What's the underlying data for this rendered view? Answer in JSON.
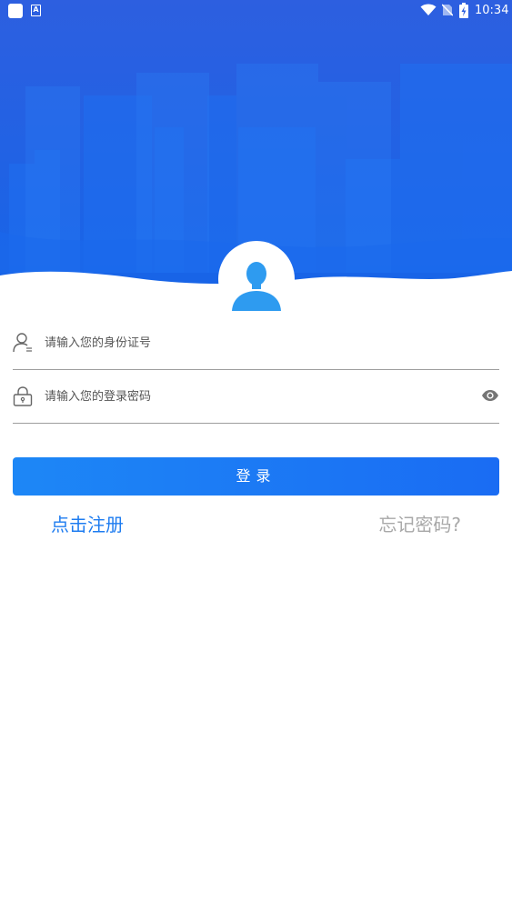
{
  "status_bar": {
    "time": "10:34",
    "left_icons": [
      "app-square-icon",
      "a-badge-icon"
    ],
    "a_badge": "A",
    "right_icons": [
      "wifi-icon",
      "no-sim-icon",
      "battery-charging-icon"
    ]
  },
  "colors": {
    "header_top": "#2d5fe0",
    "header_bottom": "#1565e8",
    "accent": "#1a6cf3",
    "register_link": "#1e7cf0",
    "forgot_link": "#a8a8a8",
    "avatar_fill": "#2e9bf0"
  },
  "avatar": {
    "icon": "user-silhouette-icon"
  },
  "form": {
    "id_field": {
      "icon": "user-id-icon",
      "placeholder": "请输入您的身份证号",
      "value": ""
    },
    "password_field": {
      "icon": "lock-icon",
      "placeholder": "请输入您的登录密码",
      "value": "",
      "toggle_icon": "eye-icon"
    },
    "login_label": "登录",
    "register_label": "点击注册",
    "forgot_label": "忘记密码?"
  }
}
